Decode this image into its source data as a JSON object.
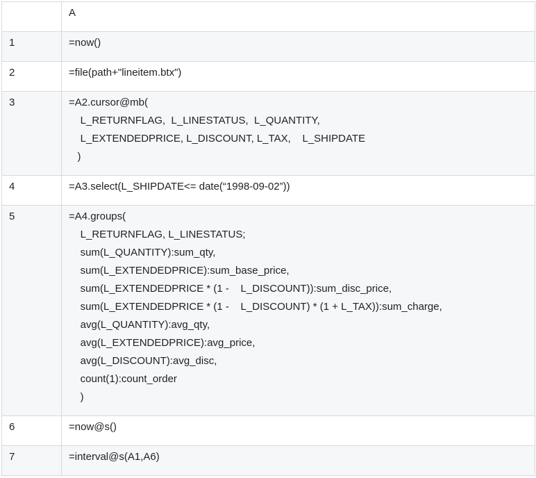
{
  "header": {
    "corner": "",
    "col_a": "A"
  },
  "rows": [
    {
      "num": "1",
      "lines": [
        "=now()"
      ]
    },
    {
      "num": "2",
      "lines": [
        "=file(path+\"lineitem.btx\")"
      ]
    },
    {
      "num": "3",
      "lines": [
        "=A2.cursor@mb(",
        "    L_RETURNFLAG,  L_LINESTATUS,  L_QUANTITY,",
        "    L_EXTENDEDPRICE, L_DISCOUNT, L_TAX,    L_SHIPDATE",
        "   )"
      ]
    },
    {
      "num": "4",
      "lines": [
        "=A3.select(L_SHIPDATE<= date(“1998-09-02”))"
      ]
    },
    {
      "num": "5",
      "lines": [
        "=A4.groups(",
        "    L_RETURNFLAG, L_LINESTATUS;",
        "    sum(L_QUANTITY):sum_qty,",
        "    sum(L_EXTENDEDPRICE):sum_base_price,",
        "    sum(L_EXTENDEDPRICE * (1 -    L_DISCOUNT)):sum_disc_price,",
        "    sum(L_EXTENDEDPRICE * (1 -    L_DISCOUNT) * (1 + L_TAX)):sum_charge,",
        "    avg(L_QUANTITY):avg_qty,",
        "    avg(L_EXTENDEDPRICE):avg_price,",
        "    avg(L_DISCOUNT):avg_disc,",
        "    count(1):count_order",
        "    )"
      ]
    },
    {
      "num": "6",
      "lines": [
        "=now@s()"
      ]
    },
    {
      "num": "7",
      "lines": [
        "=interval@s(A1,A6)"
      ]
    }
  ]
}
